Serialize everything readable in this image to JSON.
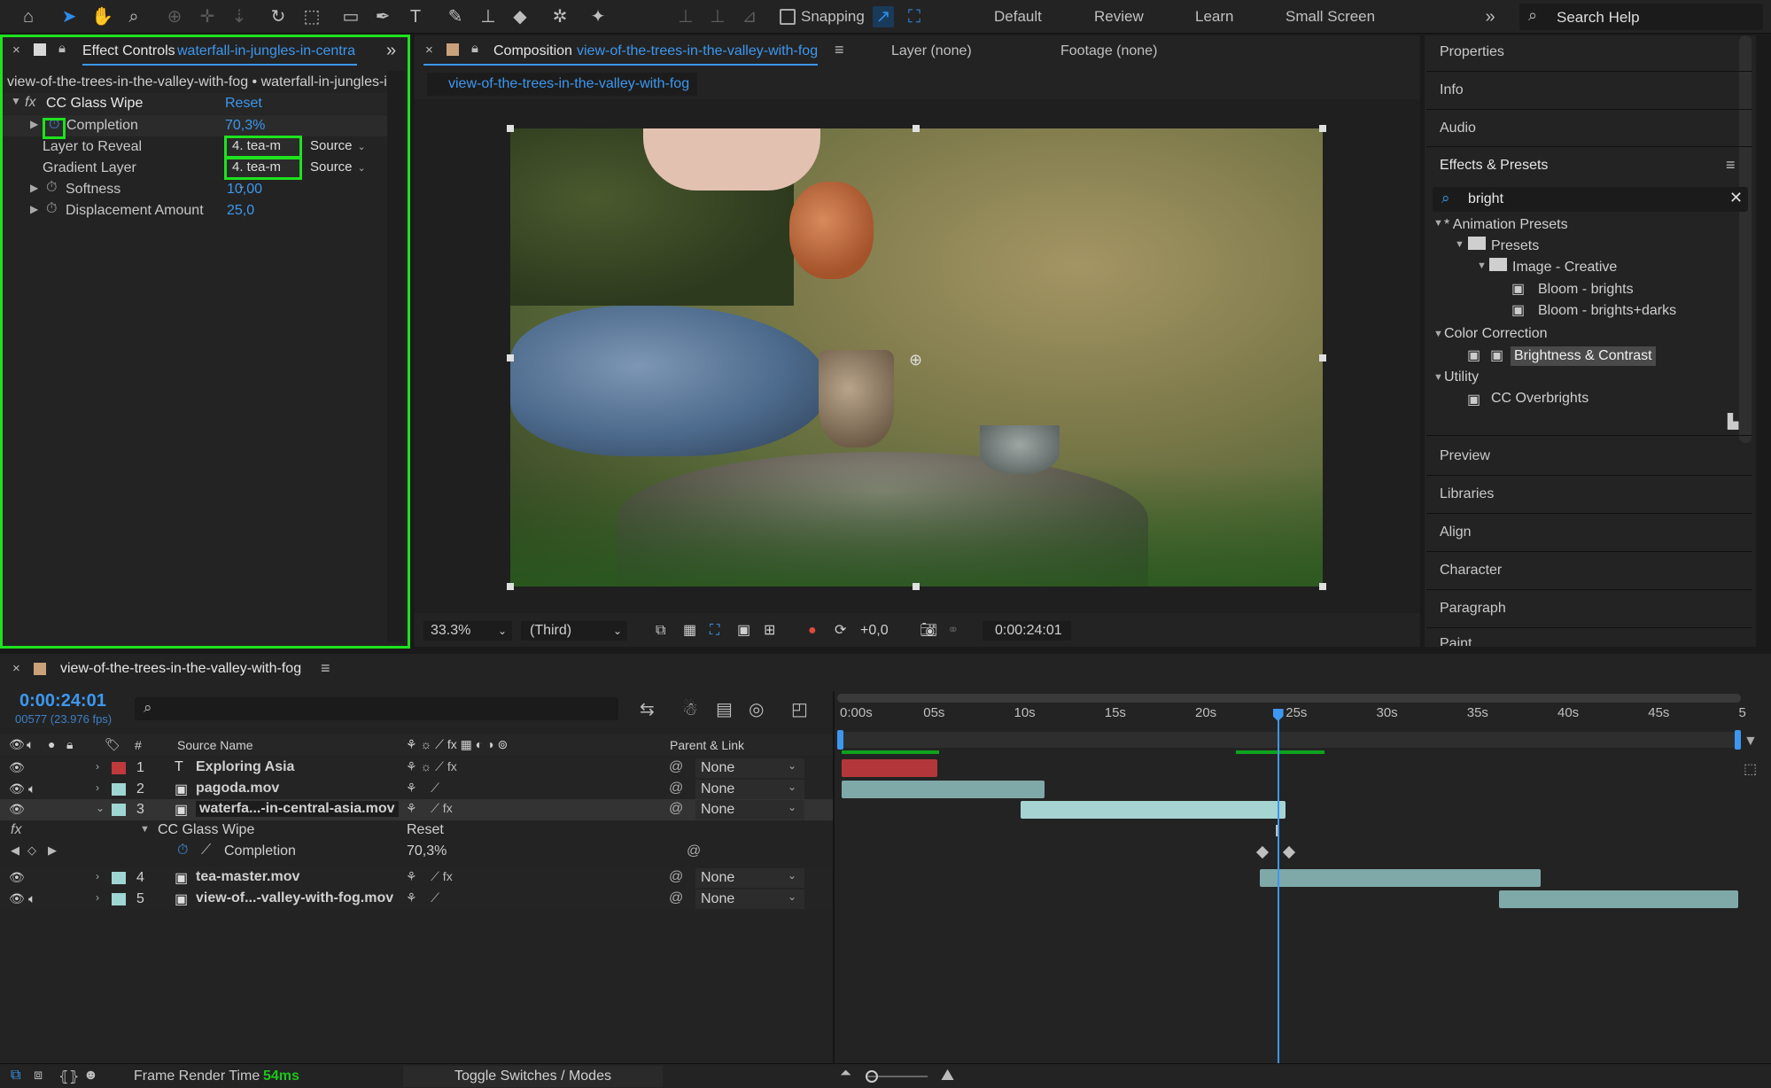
{
  "toolbar": {
    "snapping_label": "Snapping",
    "workspaces": [
      "Default",
      "Review",
      "Learn",
      "Small Screen"
    ],
    "search_placeholder": "Search Help"
  },
  "effect_controls": {
    "tab_label": "Effect Controls",
    "tab_layer": "waterfall-in-jungles-in-centra",
    "breadcrumb": "view-of-the-trees-in-the-valley-with-fog • waterfall-in-jungles-in",
    "effect_name": "CC Glass Wipe",
    "reset_label": "Reset",
    "properties": [
      {
        "name": "Completion",
        "value": "70,3%"
      },
      {
        "name": "Layer to Reveal",
        "value": "4. tea-m",
        "source": "Source"
      },
      {
        "name": "Gradient Layer",
        "value": "4. tea-m",
        "source": "Source"
      },
      {
        "name": "Softness",
        "value": "10,00"
      },
      {
        "name": "Displacement Amount",
        "value": "25,0"
      }
    ]
  },
  "composition": {
    "tab_label": "Composition",
    "tab_name": "view-of-the-trees-in-the-valley-with-fog",
    "layer_tab": "Layer (none)",
    "footage_tab": "Footage (none)",
    "sub_tab": "view-of-the-trees-in-the-valley-with-fog",
    "zoom": "33.3%",
    "resolution": "(Third)",
    "exposure": "+0,0",
    "timecode": "0:00:24:01"
  },
  "right_panel": {
    "items_top": [
      "Properties",
      "Info",
      "Audio"
    ],
    "effects_title": "Effects & Presets",
    "search_value": "bright",
    "tree": [
      {
        "label": "* Animation Presets",
        "level": 0,
        "type": "group"
      },
      {
        "label": "Presets",
        "level": 1,
        "type": "folder"
      },
      {
        "label": "Image - Creative",
        "level": 2,
        "type": "folder"
      },
      {
        "label": "Bloom - brights",
        "level": 3,
        "type": "preset"
      },
      {
        "label": "Bloom - brights+darks",
        "level": 3,
        "type": "preset"
      },
      {
        "label": "Color Correction",
        "level": 0,
        "type": "group"
      },
      {
        "label": "Brightness & Contrast",
        "level": 1,
        "type": "effect",
        "selected": true
      },
      {
        "label": "Utility",
        "level": 0,
        "type": "group"
      },
      {
        "label": "CC Overbrights",
        "level": 1,
        "type": "effect"
      }
    ],
    "items_bottom": [
      "Preview",
      "Libraries",
      "Align",
      "Character",
      "Paragraph",
      "Paint"
    ]
  },
  "timeline": {
    "comp_name": "view-of-the-trees-in-the-valley-with-fog",
    "timecode": "0:00:24:01",
    "frame_info": "00577 (23.976 fps)",
    "col_hash": "#",
    "col_source": "Source Name",
    "col_parent": "Parent & Link",
    "ruler": [
      "0:00s",
      "05s",
      "10s",
      "15s",
      "20s",
      "25s",
      "30s",
      "35s",
      "40s",
      "45s",
      "5"
    ],
    "layers": [
      {
        "num": "1",
        "name": "Exploring Asia",
        "color": "#c0393b",
        "parent": "None",
        "type": "text",
        "start": 0.0,
        "end": 5.3
      },
      {
        "num": "2",
        "name": "pagoda.mov",
        "color": "#9ed6d3",
        "parent": "None",
        "type": "footage",
        "start": 0.0,
        "end": 11.2
      },
      {
        "num": "3",
        "name": "waterfa...-in-central-asia.mov",
        "color": "#9ed6d3",
        "parent": "None",
        "type": "footage",
        "start": 9.9,
        "end": 24.5
      },
      {
        "num": "4",
        "name": "tea-master.mov",
        "color": "#9ed6d3",
        "parent": "None",
        "type": "footage",
        "start": 23.1,
        "end": 38.6
      },
      {
        "num": "5",
        "name": "view-of...-valley-with-fog.mov",
        "color": "#9ed6d3",
        "parent": "None",
        "type": "footage",
        "start": 36.3,
        "end": 50.0
      }
    ],
    "effect_row": {
      "name": "CC Glass Wipe",
      "reset": "Reset"
    },
    "property_row": {
      "name": "Completion",
      "value": "70,3%"
    },
    "playhead_seconds": 24.04
  },
  "status_bar": {
    "frame_render_label": "Frame Render Time",
    "frame_render_value": "54ms",
    "toggle_label": "Toggle Switches / Modes"
  },
  "colors": {
    "accent": "#3d97ef",
    "highlight": "#1ee21e",
    "panel": "#232323"
  }
}
